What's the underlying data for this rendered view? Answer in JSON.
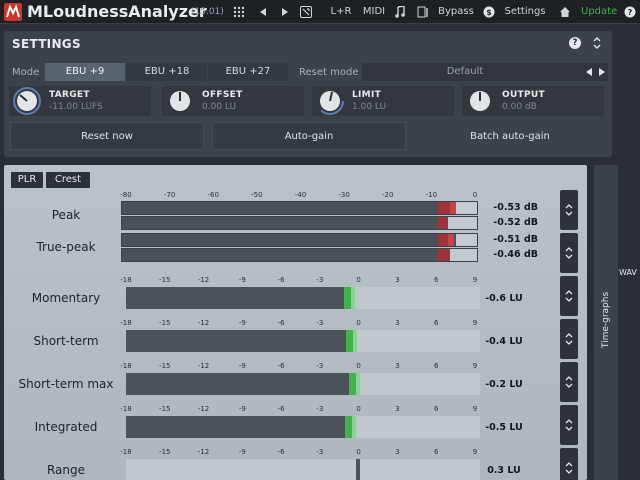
{
  "app": {
    "title": "MLoudnessAnalyzer",
    "version": "(15.01)"
  },
  "toolbar": {
    "lr_label": "L+R",
    "midi_label": "MIDI",
    "bypass_label": "Bypass",
    "settings_label": "Settings",
    "update_label": "Update",
    "update_color": "#3fb34a"
  },
  "settings": {
    "title": "SETTINGS",
    "mode_label": "Mode",
    "modes": [
      "EBU +9",
      "EBU +18",
      "EBU +27"
    ],
    "active_mode": "EBU +9",
    "reset_mode_label": "Reset mode",
    "reset_mode_value": "Default",
    "knobs": [
      {
        "label": "TARGET",
        "value": "-11.00 LUFS"
      },
      {
        "label": "OFFSET",
        "value": "0.00 LU"
      },
      {
        "label": "LIMIT",
        "value": "1.00 LU"
      },
      {
        "label": "OUTPUT",
        "value": "0.00 dB"
      }
    ],
    "buttons": {
      "reset_now": "Reset now",
      "auto_gain": "Auto-gain",
      "batch_auto_gain": "Batch auto-gain"
    }
  },
  "meters": {
    "plr_label": "PLR",
    "crest_label": "Crest",
    "db_scale": [
      "-80",
      "-70",
      "-60",
      "-50",
      "-40",
      "-30",
      "-20",
      "-10",
      "0"
    ],
    "lu_scale": [
      "-18",
      "-15",
      "-12",
      "-9",
      "-6",
      "-3",
      "0",
      "3",
      "6",
      "9"
    ],
    "peak": {
      "label": "Peak",
      "values": [
        "-0.53 dB",
        "-0.52 dB"
      ]
    },
    "true_peak": {
      "label": "True-peak",
      "values": [
        "-0.51 dB",
        "-0.46 dB"
      ]
    },
    "rows": [
      {
        "label": "Momentary",
        "value": "-0.6 LU",
        "level": -0.6
      },
      {
        "label": "Short-term",
        "value": "-0.4 LU",
        "level": -0.4
      },
      {
        "label": "Short-term max",
        "value": "-0.2 LU",
        "level": -0.2
      },
      {
        "label": "Integrated",
        "value": "-0.5 LU",
        "level": -0.5
      },
      {
        "label": "Range",
        "value": "0.3 LU",
        "level": 0.3
      }
    ],
    "time_graphs_label": "Time-graphs",
    "wav_label": "WAV"
  }
}
